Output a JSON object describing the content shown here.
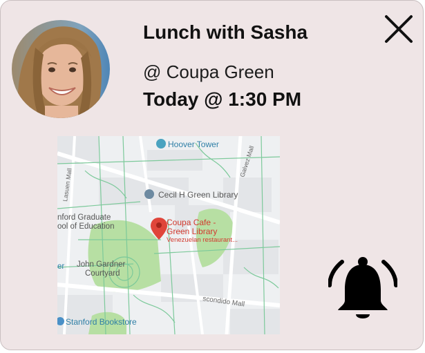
{
  "event": {
    "title": "Lunch with Sasha",
    "location": "@ Coupa Green",
    "time": "Today @ 1:30 PM"
  },
  "map": {
    "places": {
      "hoover_tower": "Hoover Tower",
      "cecil_green": "Cecil H Green Library",
      "grad_school_1": "nford Graduate",
      "grad_school_2": "ool of Education",
      "coupa_1": "Coupa Cafe -",
      "coupa_2": "Green Library",
      "coupa_sub": "Venezuelan restaurant...",
      "courtyard_1": "John Gardner",
      "courtyard_2": "Courtyard",
      "bookstore": "Stanford Bookstore",
      "escondido": "scondido Mall",
      "galvez": "Galvez Mall",
      "lasuen": "Lasuen Mall",
      "edge_er": "er"
    }
  },
  "icons": {
    "close": "close-icon",
    "bell": "bell-ringing-icon",
    "pin": "map-pin-icon"
  },
  "colors": {
    "card_bg": "#efe5e6",
    "pin": "#e0453a",
    "park": "#b7dfa3",
    "poi_blue": "#4a90c7"
  }
}
